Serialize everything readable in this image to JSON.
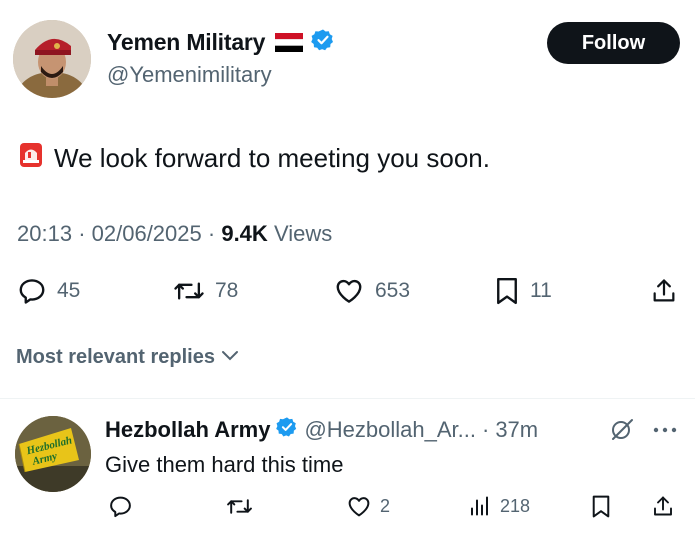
{
  "tweet": {
    "author_name": "Yemen Military",
    "author_flag": "🇾🇪",
    "author_handle": "@Yemenimilitary",
    "follow_label": "Follow",
    "text": "We look forward to meeting you soon.",
    "time": "20:13",
    "date": "02/06/2025",
    "views_count": "9.4K",
    "views_label": "Views",
    "replies": "45",
    "reposts": "78",
    "likes": "653",
    "bookmarks": "11",
    "verified_color": "#1d9bf0"
  },
  "sort": {
    "label": "Most relevant replies"
  },
  "reply": {
    "author_name": "Hezbollah Army",
    "author_handle": "@Hezbollah_Ar...",
    "separator": "·",
    "age": "37m",
    "text": "Give them hard this time",
    "replies": "",
    "reposts": "",
    "likes": "2",
    "views": "218",
    "avatar_text": "Hezbollah Army"
  }
}
